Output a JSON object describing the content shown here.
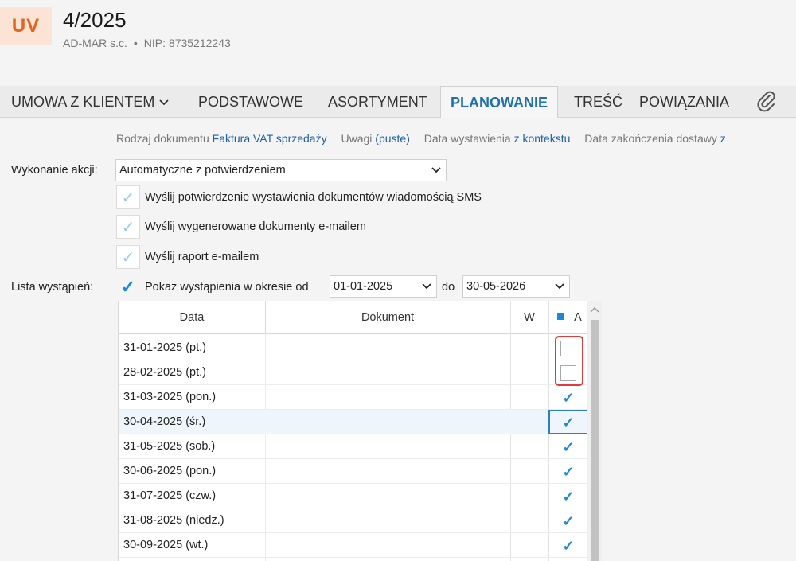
{
  "header": {
    "badge": "UV",
    "title": "4/2025",
    "company": "AD-MAR s.c.",
    "separator": "•",
    "nip": "NIP: 8735212243"
  },
  "tabs": [
    {
      "label": "UMOWA Z KLIENTEM",
      "has_dropdown": true
    },
    {
      "label": "PODSTAWOWE"
    },
    {
      "label": "ASORTYMENT"
    },
    {
      "label": "PLANOWANIE",
      "active": true
    },
    {
      "label": "TREŚĆ"
    },
    {
      "label": "POWIĄZANIA"
    }
  ],
  "attachment_icon": "paperclip-icon",
  "infoline": {
    "doc_type_label": "Rodzaj dokumentu",
    "doc_type_value": "Faktura VAT sprzedaży",
    "notes_label": "Uwagi",
    "notes_value": "(puste)",
    "issue_date_label": "Data wystawienia",
    "issue_date_value": "z kontekstu",
    "delivery_end_label": "Data zakończenia dostawy",
    "delivery_end_value": "z"
  },
  "form": {
    "action_label": "Wykonanie akcji:",
    "action_value": "Automatyczne z potwierdzeniem",
    "opt_sms": "Wyślij potwierdzenie wystawienia dokumentów wiadomością SMS",
    "opt_email_docs": "Wyślij wygenerowane dokumenty e-mailem",
    "opt_report": "Wyślij raport e-mailem",
    "list_label": "Lista wystąpień:",
    "show_period_label": "Pokaż wystąpienia w okresie od",
    "date_from": "01-01-2025",
    "to_label": "do",
    "date_to": "30-05-2026"
  },
  "grid": {
    "headers": {
      "date": "Data",
      "document": "Dokument",
      "w": "W",
      "a": "A"
    },
    "rows": [
      {
        "date": "31-01-2025 (pt.)",
        "checked": false
      },
      {
        "date": "28-02-2025 (pt.)",
        "checked": false
      },
      {
        "date": "31-03-2025 (pon.)",
        "checked": true
      },
      {
        "date": "30-04-2025 (śr.)",
        "checked": true,
        "selected": true
      },
      {
        "date": "31-05-2025 (sob.)",
        "checked": true
      },
      {
        "date": "30-06-2025 (pon.)",
        "checked": true
      },
      {
        "date": "31-07-2025 (czw.)",
        "checked": true
      },
      {
        "date": "31-08-2025 (niedz.)",
        "checked": true
      },
      {
        "date": "30-09-2025 (wt.)",
        "checked": true
      }
    ]
  },
  "colors": {
    "accent": "#1f6fb2",
    "badge_bg": "#fbe3d6",
    "badge_fg": "#e0661f",
    "highlight": "#e23a3a"
  }
}
